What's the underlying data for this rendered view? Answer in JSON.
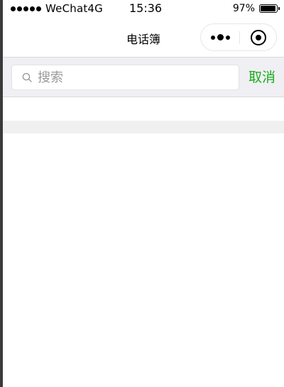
{
  "status_bar": {
    "carrier": "WeChat4G",
    "time": "15:36",
    "battery_percent": "97%",
    "battery_level": 0.97
  },
  "nav_bar": {
    "title": "电话簿",
    "capsule": {
      "more_icon": "more-dots-icon",
      "close_icon": "target-icon"
    }
  },
  "search": {
    "placeholder": "搜索",
    "value": "",
    "cancel_label": "取消",
    "icon": "search-icon"
  },
  "colors": {
    "accent_green": "#1aad19",
    "search_bg": "#efeff4",
    "separator": "#f0f0f0"
  }
}
